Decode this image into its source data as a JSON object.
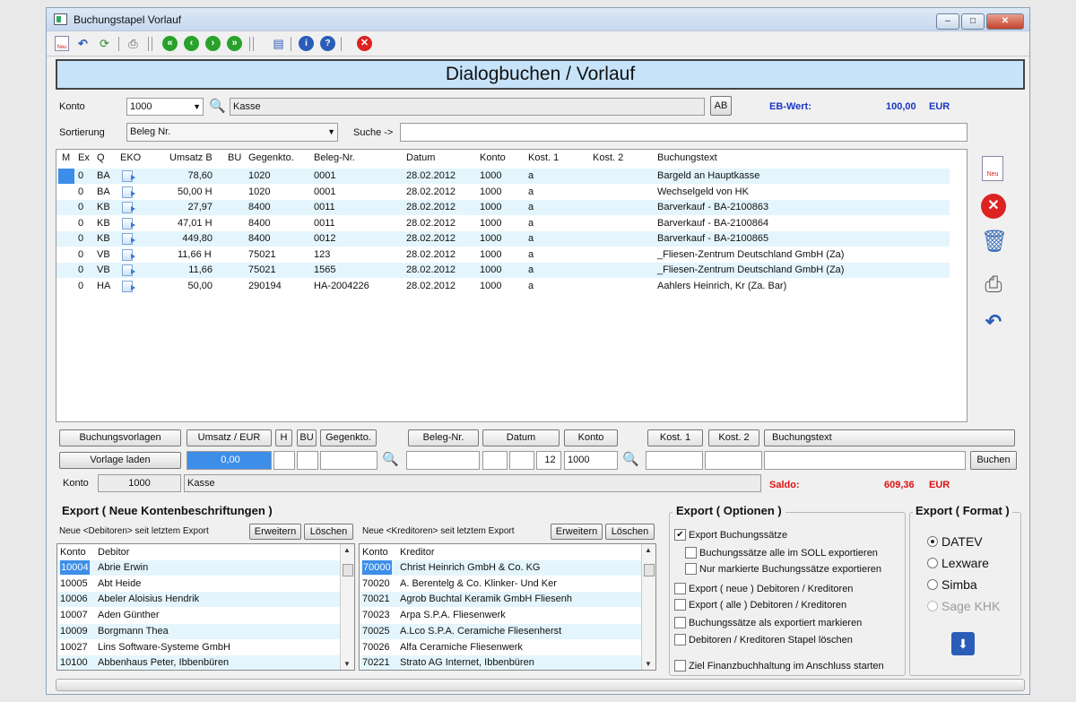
{
  "window": {
    "title": "Buchungstapel Vorlauf",
    "min": "–",
    "max": "□",
    "close": "✕"
  },
  "toolbar": {
    "new_label": "Neu"
  },
  "header": {
    "title": "Dialogbuchen / Vorlauf"
  },
  "konto_section": {
    "konto_label": "Konto",
    "konto_value": "1000",
    "konto_name": "Kasse",
    "ab_button": "AB",
    "eb_label": "EB-Wert:",
    "eb_value": "100,00",
    "eb_currency": "EUR",
    "sort_label": "Sortierung",
    "sort_value": "Beleg Nr.",
    "search_label": "Suche ->",
    "search_value": ""
  },
  "grid": {
    "headers": [
      "M",
      "Ex",
      "Q",
      "EKO",
      "Umsatz B",
      "BU",
      "Gegenkto.",
      "Beleg-Nr.",
      "Datum",
      "Konto",
      "Kost. 1",
      "Kost. 2",
      "Buchungstext"
    ],
    "rows": [
      {
        "ex": "0",
        "q": "BA",
        "umsatz": "78,60",
        "bu": "",
        "gegenkto": "1020",
        "beleg": "0001",
        "datum": "28.02.2012",
        "konto": "1000",
        "kost1": "a",
        "kost2": "",
        "text": "Bargeld an Hauptkasse"
      },
      {
        "ex": "0",
        "q": "BA",
        "umsatz": "50,00 H",
        "bu": "",
        "gegenkto": "1020",
        "beleg": "0001",
        "datum": "28.02.2012",
        "konto": "1000",
        "kost1": "a",
        "kost2": "",
        "text": "Wechselgeld von HK"
      },
      {
        "ex": "0",
        "q": "KB",
        "umsatz": "27,97",
        "bu": "",
        "gegenkto": "8400",
        "beleg": "0011",
        "datum": "28.02.2012",
        "konto": "1000",
        "kost1": "a",
        "kost2": "",
        "text": "Barverkauf - BA-2100863"
      },
      {
        "ex": "0",
        "q": "KB",
        "umsatz": "47,01 H",
        "bu": "",
        "gegenkto": "8400",
        "beleg": "0011",
        "datum": "28.02.2012",
        "konto": "1000",
        "kost1": "a",
        "kost2": "",
        "text": "Barverkauf - BA-2100864"
      },
      {
        "ex": "0",
        "q": "KB",
        "umsatz": "449,80",
        "bu": "",
        "gegenkto": "8400",
        "beleg": "0012",
        "datum": "28.02.2012",
        "konto": "1000",
        "kost1": "a",
        "kost2": "",
        "text": "Barverkauf - BA-2100865"
      },
      {
        "ex": "0",
        "q": "VB",
        "umsatz": "11,66 H",
        "bu": "",
        "gegenkto": "75021",
        "beleg": "123",
        "datum": "28.02.2012",
        "konto": "1000",
        "kost1": "a",
        "kost2": "",
        "text": "_Fliesen-Zentrum Deutschland GmbH (Za)"
      },
      {
        "ex": "0",
        "q": "VB",
        "umsatz": "11,66",
        "bu": "",
        "gegenkto": "75021",
        "beleg": "1565",
        "datum": "28.02.2012",
        "konto": "1000",
        "kost1": "a",
        "kost2": "",
        "text": "_Fliesen-Zentrum Deutschland GmbH (Za)"
      },
      {
        "ex": "0",
        "q": "HA",
        "umsatz": "50,00",
        "bu": "",
        "gegenkto": "290194",
        "beleg": "HA-2004226",
        "datum": "28.02.2012",
        "konto": "1000",
        "kost1": "a",
        "kost2": "",
        "text": "Aahlers Heinrich, Kr (Za. Bar)"
      }
    ]
  },
  "entry": {
    "vorlagen_label": "Buchungsvorlagen",
    "umsatz_label": "Umsatz / EUR",
    "h_label": "H",
    "bu_label": "BU",
    "gegenkto_label": "Gegenkto.",
    "beleg_label": "Beleg-Nr.",
    "datum_label": "Datum",
    "konto_label": "Konto",
    "kost1_label": "Kost. 1",
    "kost2_label": "Kost. 2",
    "text_label": "Buchungstext",
    "vorlage_button": "Vorlage laden",
    "umsatz_value": "0,00",
    "datum_month": "12",
    "konto_value": "1000",
    "buchen_button": "Buchen"
  },
  "saldo_row": {
    "konto_label": "Konto",
    "konto_value": "1000",
    "konto_name": "Kasse",
    "saldo_label": "Saldo:",
    "saldo_value": "609,36",
    "saldo_currency": "EUR"
  },
  "export_accounts": {
    "title": "Export ( Neue Kontenbeschriftungen )",
    "debitor_caption": "Neue <Debitoren> seit letztem Export",
    "kreditor_caption": "Neue <Kreditoren> seit letztem Export",
    "erweitern": "Erweitern",
    "loeschen": "Löschen",
    "debitor_headers": [
      "Konto",
      "Debitor"
    ],
    "kreditor_headers": [
      "Konto",
      "Kreditor"
    ],
    "debitors": [
      {
        "konto": "10004",
        "name": "Abrie Erwin"
      },
      {
        "konto": "10005",
        "name": "Abt Heide"
      },
      {
        "konto": "10006",
        "name": "Abeler Aloisius Hendrik"
      },
      {
        "konto": "10007",
        "name": "Aden Günther"
      },
      {
        "konto": "10009",
        "name": "Borgmann Thea"
      },
      {
        "konto": "10027",
        "name": "Lins Software-Systeme GmbH"
      },
      {
        "konto": "10100",
        "name": "Abbenhaus Peter, Ibbenbüren"
      }
    ],
    "kreditors": [
      {
        "konto": "70000",
        "name": "Christ Heinrich GmbH & Co. KG"
      },
      {
        "konto": "70020",
        "name": "A. Berentelg & Co. Klinker- Und Ker"
      },
      {
        "konto": "70021",
        "name": "Agrob Buchtal Keramik GmbH Fliesenh"
      },
      {
        "konto": "70023",
        "name": "Arpa S.P.A. Fliesenwerk"
      },
      {
        "konto": "70025",
        "name": "A.Lco S.P.A. Ceramiche Fliesenherst"
      },
      {
        "konto": "70026",
        "name": "Alfa Ceramiche Fliesenwerk"
      },
      {
        "konto": "70221",
        "name": "Strato AG Internet, Ibbenbüren"
      }
    ]
  },
  "export_options": {
    "title": "Export ( Optionen )",
    "options": [
      {
        "label": "Export Buchungssätze",
        "checked": true
      },
      {
        "label": "Buchungssätze alle im SOLL exportieren",
        "checked": false
      },
      {
        "label": "Nur markierte Buchungssätze exportieren",
        "checked": false
      },
      {
        "label": "Export ( neue ) Debitoren / Kreditoren",
        "checked": false
      },
      {
        "label": "Export ( alle ) Debitoren / Kreditoren",
        "checked": false
      },
      {
        "label": "Buchungssätze als exportiert markieren",
        "checked": false
      },
      {
        "label": "Debitoren / Kreditoren Stapel löschen",
        "checked": false
      },
      {
        "label": "Ziel Finanzbuchhaltung im Anschluss starten",
        "checked": false
      }
    ]
  },
  "export_format": {
    "title": "Export ( Format )",
    "formats": [
      {
        "label": "DATEV",
        "selected": true,
        "enabled": true
      },
      {
        "label": "Lexware",
        "selected": false,
        "enabled": true
      },
      {
        "label": "Simba",
        "selected": false,
        "enabled": true
      },
      {
        "label": "Sage KHK",
        "selected": false,
        "enabled": false
      }
    ]
  },
  "colors": {
    "header_bg": "#c7e3f9",
    "row_alt": "#e4f5fd",
    "accent_blue": "#1b36c4",
    "saldo_red": "#d11111"
  }
}
